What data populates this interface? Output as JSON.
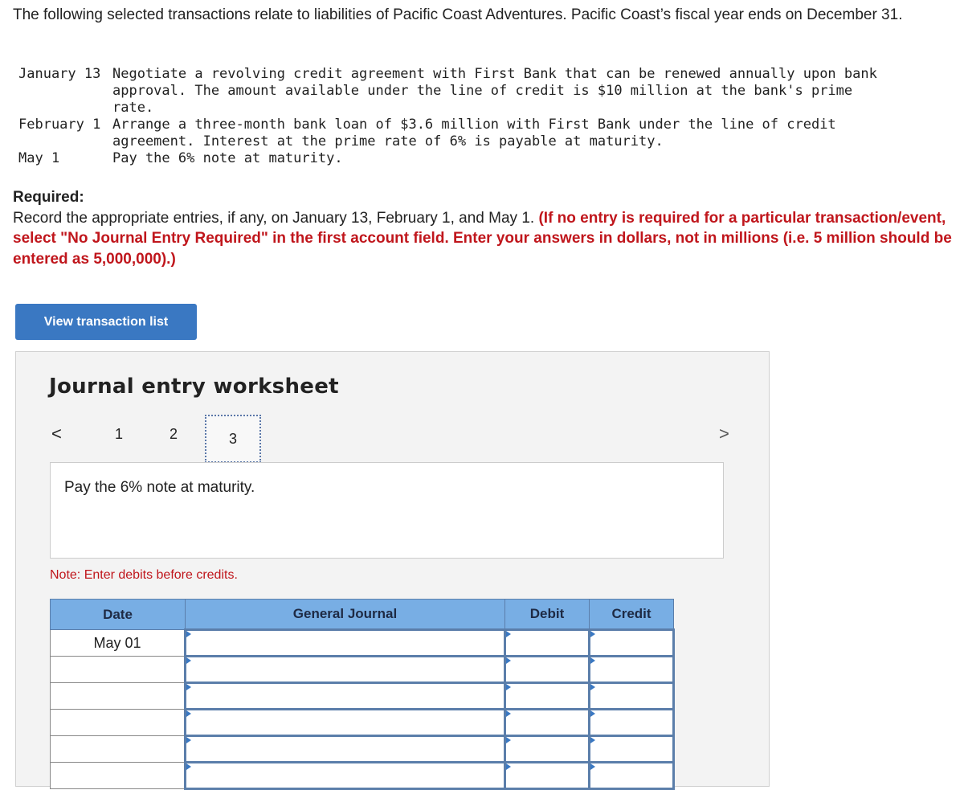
{
  "intro": "The following selected transactions relate to liabilities of Pacific Coast Adventures. Pacific Coast’s fiscal year ends on December 31.",
  "transactions": [
    {
      "date": "January 13",
      "text": "Negotiate a revolving credit agreement with First Bank that can be renewed annually upon bank\napproval. The amount available under the line of credit is $10 million at the bank's prime\nrate."
    },
    {
      "date": "February 1",
      "text": "Arrange a three-month bank loan of $3.6 million with First Bank under the line of credit\nagreement. Interest at the prime rate of 6% is payable at maturity."
    },
    {
      "date": "May 1",
      "text": "Pay the 6% note at maturity."
    }
  ],
  "required": {
    "heading": "Required:",
    "text": "Record the appropriate entries, if any, on January 13, February 1, and May 1.",
    "instruction": "(If no entry is required for a particular transaction/event, select \"No Journal Entry Required\" in the first account field. Enter your answers in dollars, not in millions (i.e. 5 million should be entered as 5,000,000).)"
  },
  "view_button": "View transaction list",
  "worksheet": {
    "title": "Journal entry worksheet",
    "prev": "<",
    "next": ">",
    "pages": [
      "1",
      "2",
      "3"
    ],
    "current_page": "3",
    "description": "Pay the 6% note at maturity.",
    "note": "Note: Enter debits before credits.",
    "columns": [
      "Date",
      "General Journal",
      "Debit",
      "Credit"
    ],
    "rows": [
      {
        "date": "May 01"
      },
      {
        "date": ""
      },
      {
        "date": ""
      },
      {
        "date": ""
      },
      {
        "date": ""
      },
      {
        "date": ""
      }
    ]
  }
}
